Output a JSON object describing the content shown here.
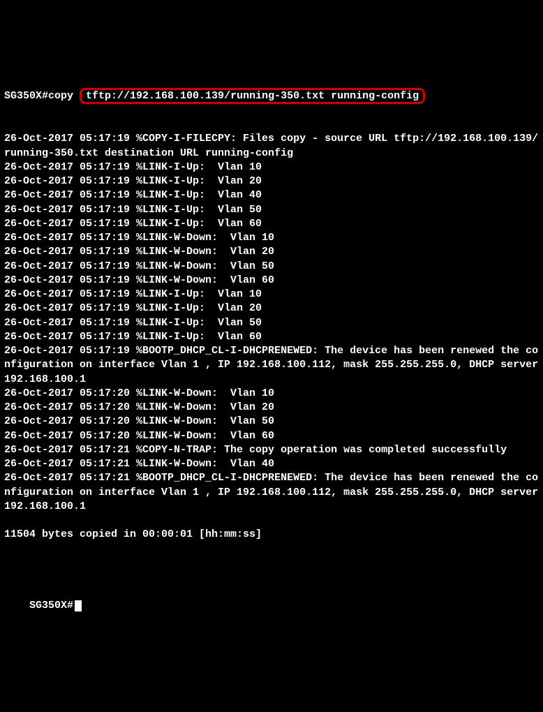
{
  "prompt_start": "SG350X#copy ",
  "highlighted_command": "tftp://192.168.100.139/running-350.txt running-config",
  "log_lines": [
    "26-Oct-2017 05:17:19 %COPY-I-FILECPY: Files copy - source URL tftp://192.168.100.139/running-350.txt destination URL running-config",
    "26-Oct-2017 05:17:19 %LINK-I-Up:  Vlan 10",
    "26-Oct-2017 05:17:19 %LINK-I-Up:  Vlan 20",
    "26-Oct-2017 05:17:19 %LINK-I-Up:  Vlan 40",
    "26-Oct-2017 05:17:19 %LINK-I-Up:  Vlan 50",
    "26-Oct-2017 05:17:19 %LINK-I-Up:  Vlan 60",
    "26-Oct-2017 05:17:19 %LINK-W-Down:  Vlan 10",
    "26-Oct-2017 05:17:19 %LINK-W-Down:  Vlan 20",
    "26-Oct-2017 05:17:19 %LINK-W-Down:  Vlan 50",
    "26-Oct-2017 05:17:19 %LINK-W-Down:  Vlan 60",
    "26-Oct-2017 05:17:19 %LINK-I-Up:  Vlan 10",
    "26-Oct-2017 05:17:19 %LINK-I-Up:  Vlan 20",
    "26-Oct-2017 05:17:19 %LINK-I-Up:  Vlan 50",
    "26-Oct-2017 05:17:19 %LINK-I-Up:  Vlan 60",
    "26-Oct-2017 05:17:19 %BOOTP_DHCP_CL-I-DHCPRENEWED: The device has been renewed the configuration on interface Vlan 1 , IP 192.168.100.112, mask 255.255.255.0, DHCP server 192.168.100.1",
    "26-Oct-2017 05:17:20 %LINK-W-Down:  Vlan 10",
    "26-Oct-2017 05:17:20 %LINK-W-Down:  Vlan 20",
    "26-Oct-2017 05:17:20 %LINK-W-Down:  Vlan 50",
    "26-Oct-2017 05:17:20 %LINK-W-Down:  Vlan 60",
    "26-Oct-2017 05:17:21 %COPY-N-TRAP: The copy operation was completed successfully",
    "26-Oct-2017 05:17:21 %LINK-W-Down:  Vlan 40",
    "26-Oct-2017 05:17:21 %BOOTP_DHCP_CL-I-DHCPRENEWED: The device has been renewed the configuration on interface Vlan 1 , IP 192.168.100.112, mask 255.255.255.0, DHCP server 192.168.100.1",
    "",
    "11504 bytes copied in 00:00:01 [hh:mm:ss]",
    ""
  ],
  "prompt_end": "SG350X#"
}
